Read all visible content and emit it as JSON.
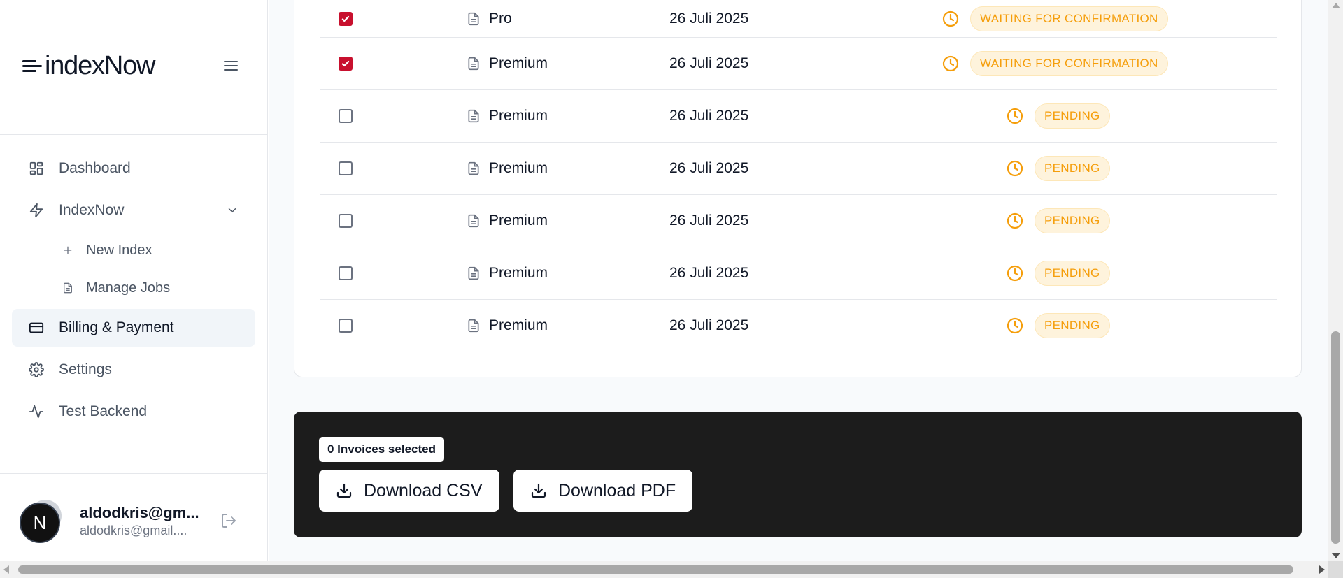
{
  "sidebar": {
    "logo_text": "indexNow",
    "nav": {
      "dashboard": "Dashboard",
      "indexnow": "IndexNow",
      "new_index": "New Index",
      "manage_jobs": "Manage Jobs",
      "billing": "Billing & Payment",
      "settings": "Settings",
      "test_backend": "Test Backend"
    },
    "user": {
      "avatar_initial": "N",
      "name": "aldodkris@gm...",
      "email": "aldodkris@gmail...."
    }
  },
  "invoices": [
    {
      "checked": true,
      "plan": "Pro",
      "date": "26 Juli 2025",
      "status": "WAITING FOR CONFIRMATION"
    },
    {
      "checked": true,
      "plan": "Premium",
      "date": "26 Juli 2025",
      "status": "WAITING FOR CONFIRMATION"
    },
    {
      "checked": false,
      "plan": "Premium",
      "date": "26 Juli 2025",
      "status": "PENDING"
    },
    {
      "checked": false,
      "plan": "Premium",
      "date": "26 Juli 2025",
      "status": "PENDING"
    },
    {
      "checked": false,
      "plan": "Premium",
      "date": "26 Juli 2025",
      "status": "PENDING"
    },
    {
      "checked": false,
      "plan": "Premium",
      "date": "26 Juli 2025",
      "status": "PENDING"
    },
    {
      "checked": false,
      "plan": "Premium",
      "date": "26 Juli 2025",
      "status": "PENDING"
    }
  ],
  "export": {
    "selected_label": "0 Invoices selected",
    "csv_label": "Download CSV",
    "pdf_label": "Download PDF"
  },
  "colors": {
    "accent_checkbox": "#c8102e",
    "status_amber": "#f59e0b",
    "export_panel_bg": "#1c1c1c"
  },
  "icons": {
    "plan": "file-text-icon",
    "status": "clock-icon",
    "download": "download-icon"
  }
}
